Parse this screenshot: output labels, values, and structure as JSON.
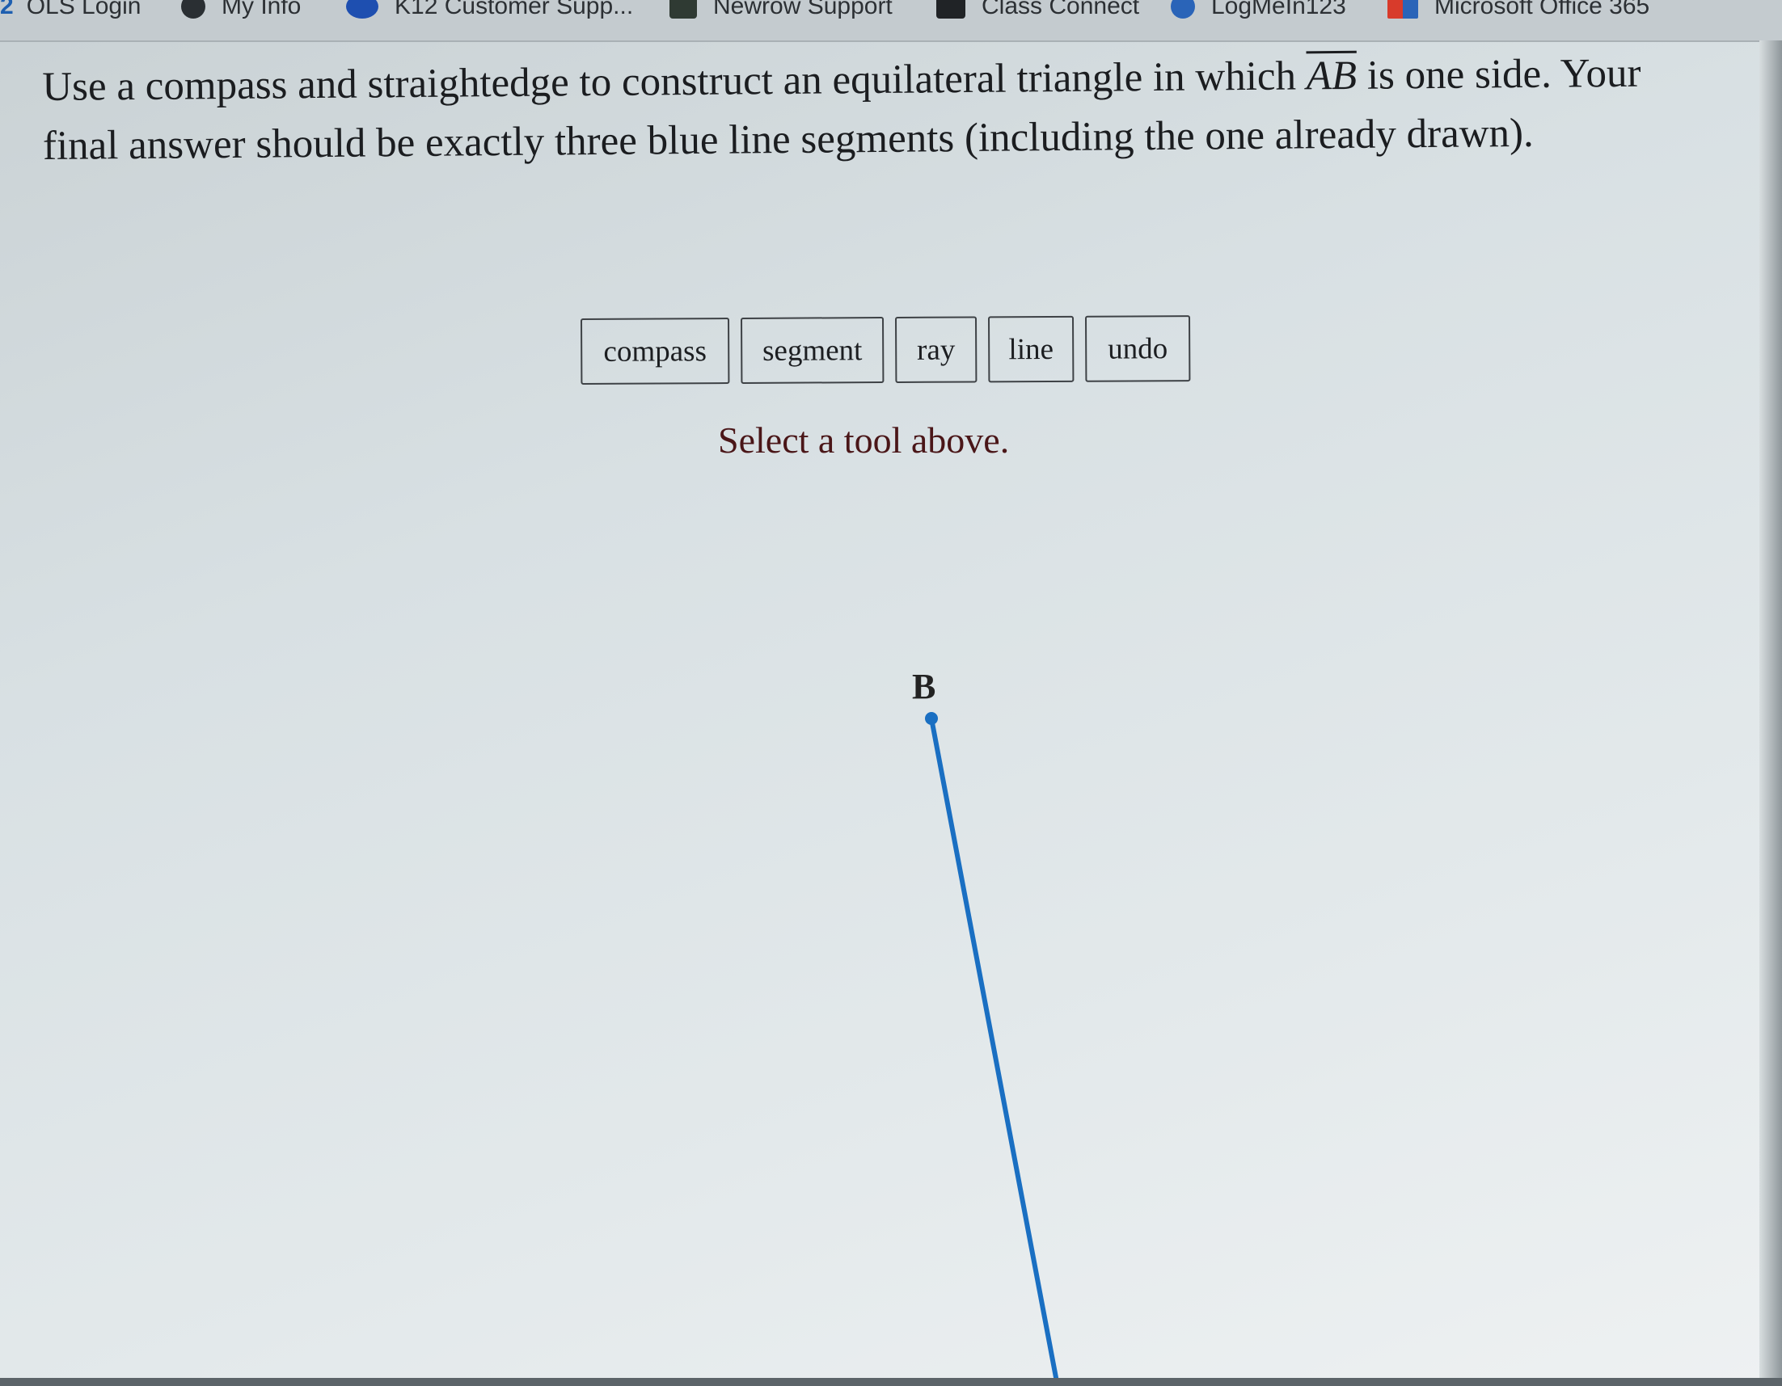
{
  "bookmarks": [
    {
      "label": "OLS Login",
      "icon": "ols-icon",
      "prefix": "2"
    },
    {
      "label": "My Info",
      "icon": "globe-icon"
    },
    {
      "label": "K12 Customer Supp...",
      "icon": "chat-bubble-icon"
    },
    {
      "label": "Newrow Support",
      "icon": "newrow-icon"
    },
    {
      "label": "Class Connect",
      "icon": "class-connect-icon"
    },
    {
      "label": "LogMeIn123",
      "icon": "plus-circle-icon"
    },
    {
      "label": "Microsoft Office 365",
      "icon": "office-icon"
    }
  ],
  "question": {
    "before": "Use a compass and straightedge to construct an equilateral triangle in which ",
    "segment": "AB",
    "after": " is one side. Your final answer should be exactly three blue line segments (including the one already drawn)."
  },
  "toolbar": {
    "compass": "compass",
    "segment": "segment",
    "ray": "ray",
    "line": "line",
    "undo": "undo"
  },
  "status": "Select a tool above.",
  "drawing": {
    "point_label": "B",
    "segment_color": "#1a6fc2"
  }
}
